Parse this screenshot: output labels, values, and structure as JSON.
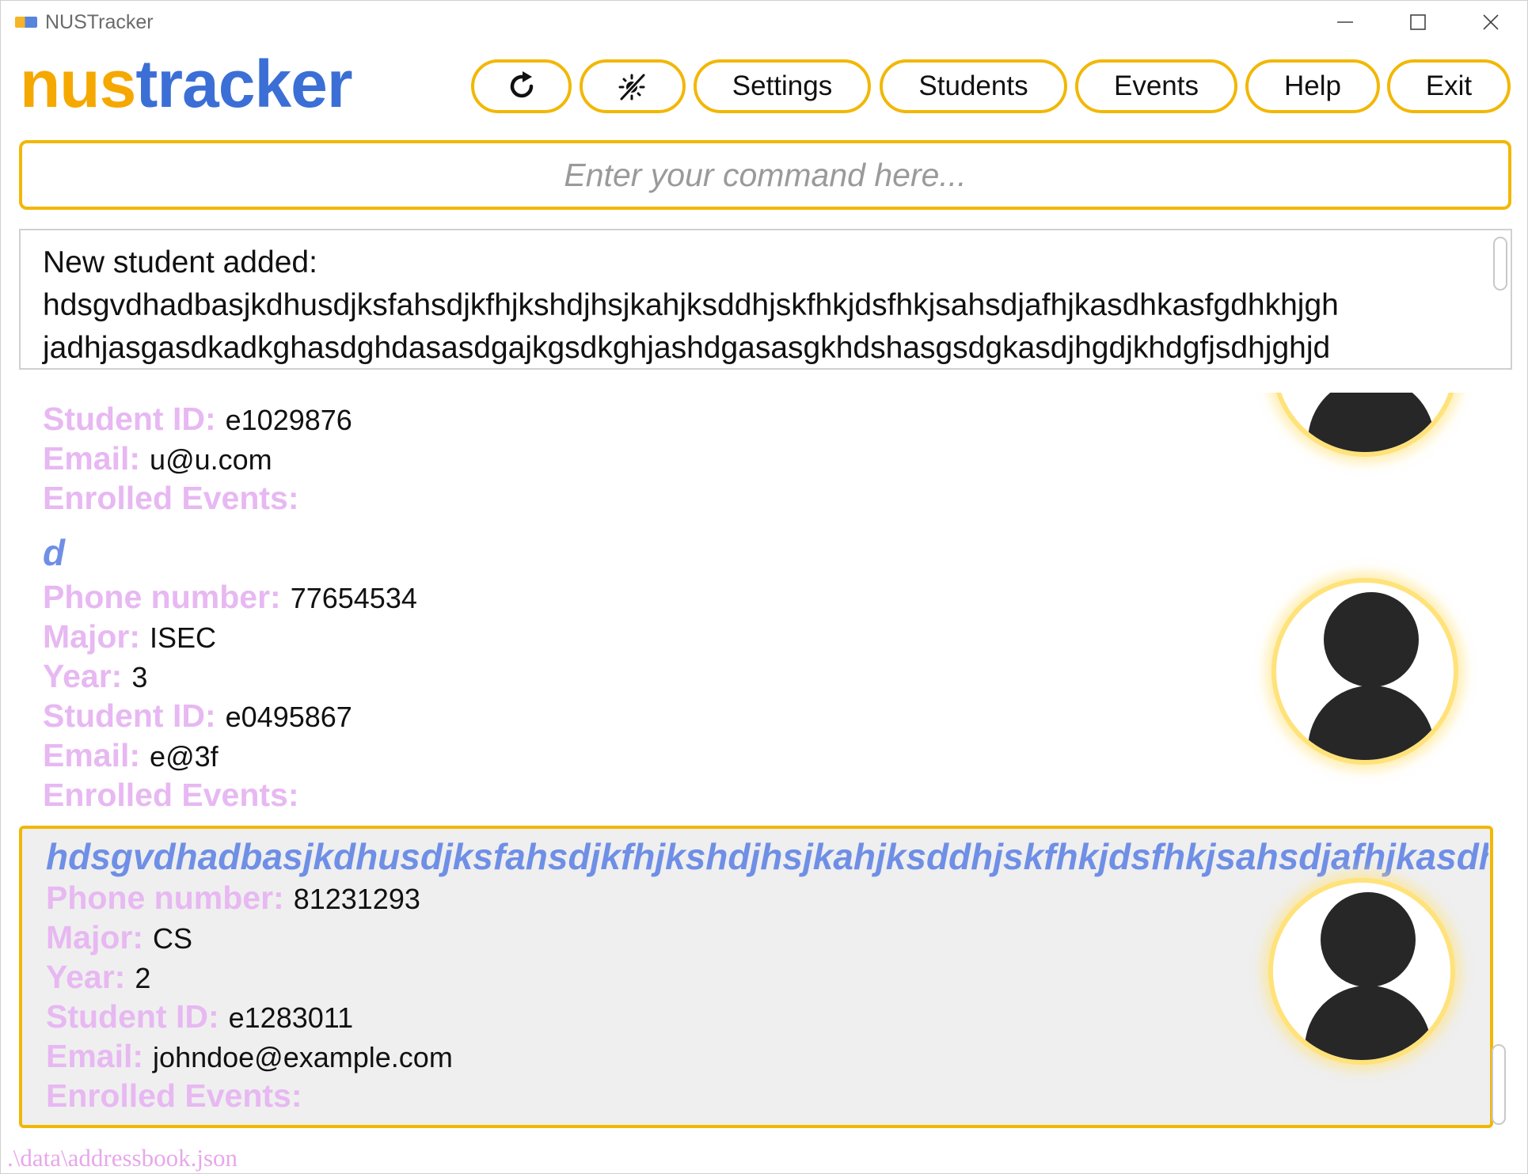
{
  "window": {
    "title": "NUSTracker"
  },
  "logo": {
    "nus": "nus",
    "tracker": "tracker"
  },
  "toolbar": {
    "refresh_icon": "refresh-icon",
    "theme_icon": "theme-toggle-icon",
    "settings": "Settings",
    "students": "Students",
    "events": "Events",
    "help": "Help",
    "exit": "Exit"
  },
  "command": {
    "placeholder": "Enter your command here...",
    "value": ""
  },
  "result": {
    "line1": "New student added:",
    "line2": "hdsgvdhadbasjkdhusdjksfahsdjkfhjkshdjhsjkahjksddhjskfhkjdsfhkjsahsdjafhjkasdhkasfgdhkhjgh",
    "line3": "jadhjasgasdkadkghasdghdasasdgajkgsdkghjashdgasasgkhdshasgsdgkasdjhgdjkhdgfjsdhjghjd"
  },
  "labels": {
    "phone": "Phone number:",
    "major": "Major:",
    "year": "Year:",
    "id": "Student ID:",
    "email": "Email:",
    "events": "Enrolled Events:"
  },
  "students": [
    {
      "id": "e1029876",
      "email": "u@u.com",
      "events": ""
    },
    {
      "name": "d",
      "phone": "77654534",
      "major": "ISEC",
      "year": "3",
      "id": "e0495867",
      "email": "e@3f",
      "events": ""
    },
    {
      "name": "hdsgvdhadbasjkdhusdjksfahsdjkfhjkshdjhsjkahjksddhjskfhkjdsfhkjsahsdjafhjkasdhkasfgdhkhjgh",
      "phone": "81231293",
      "major": "CS",
      "year": "2",
      "id": "e1283011",
      "email": "johndoe@example.com",
      "events": ""
    }
  ],
  "footer": {
    "path": ".\\data\\addressbook.json"
  },
  "colors": {
    "accent": "#f2b705",
    "brand_orange": "#f5a800",
    "brand_blue": "#3b6fd6",
    "label": "#e7b8f2",
    "name": "#6f8fe6"
  }
}
